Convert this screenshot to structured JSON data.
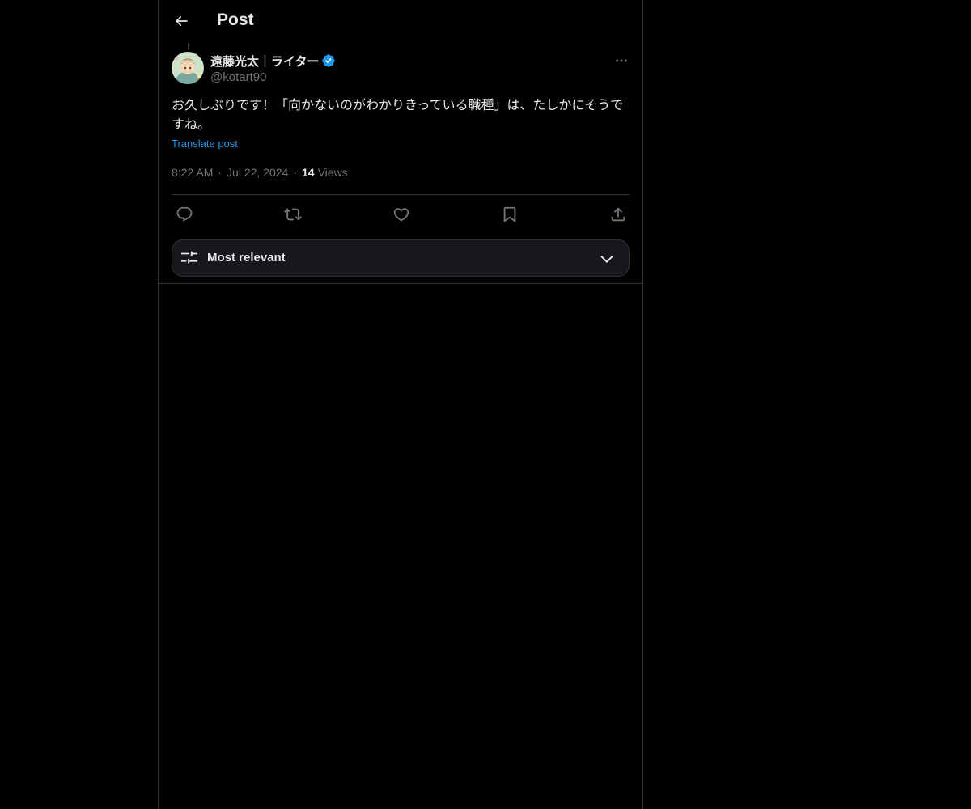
{
  "header": {
    "title": "Post",
    "back_icon": "arrow-left-icon"
  },
  "post": {
    "author": {
      "display_name": "遠藤光太｜ライター",
      "handle": "@kotart90",
      "verified": true,
      "verified_color": "#1d9bf0"
    },
    "text": "お久しぶりです！「向かないのがわかりきっている職種」は、たしかにそうですね。",
    "translate_label": "Translate post",
    "time": "8:22 AM",
    "date": "Jul 22, 2024",
    "separator": "·",
    "views_count": "14",
    "views_label": "Views"
  },
  "actions": [
    {
      "name": "reply",
      "icon": "reply-icon"
    },
    {
      "name": "repost",
      "icon": "repost-icon"
    },
    {
      "name": "like",
      "icon": "heart-icon"
    },
    {
      "name": "bookmark",
      "icon": "bookmark-icon"
    },
    {
      "name": "share",
      "icon": "share-icon"
    }
  ],
  "sort": {
    "label": "Most relevant",
    "icon": "filter-sliders-icon"
  },
  "colors": {
    "background": "#000000",
    "text": "#e7e9ea",
    "muted": "#71767b",
    "link": "#1d9bf0",
    "border": "#2f3336"
  }
}
